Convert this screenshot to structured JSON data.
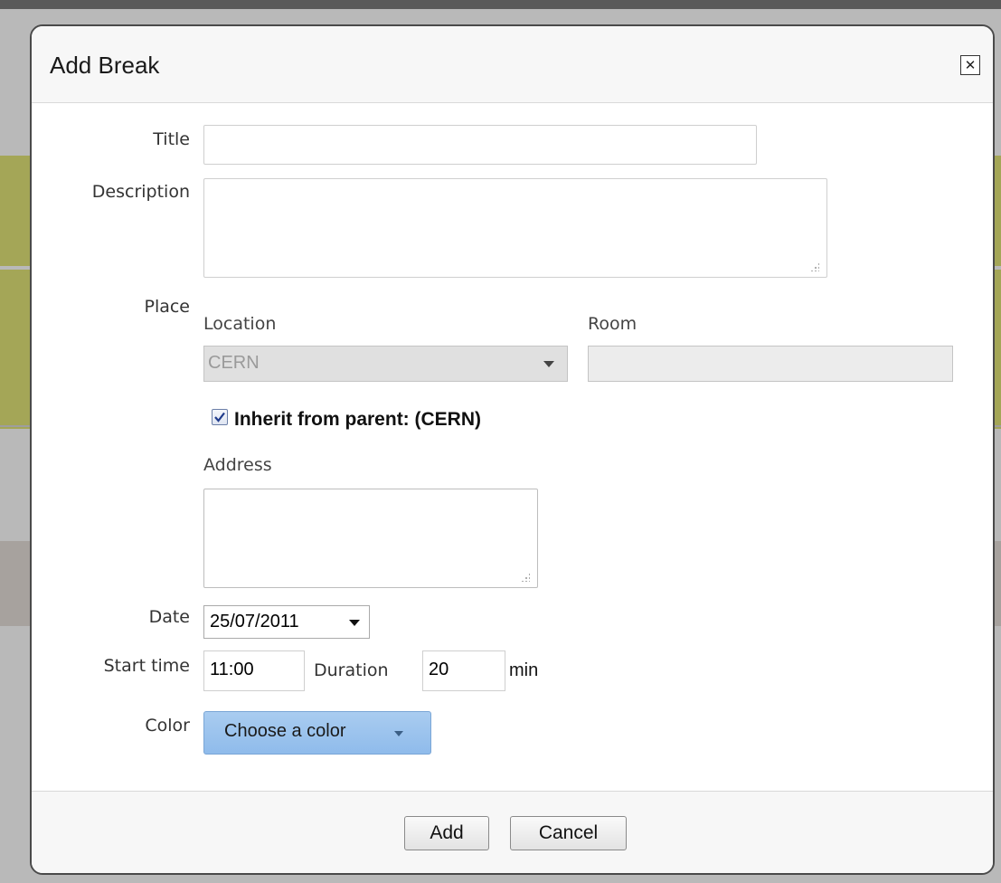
{
  "dialog": {
    "title": "Add Break",
    "close_icon": "close-icon"
  },
  "form": {
    "title_label": "Title",
    "title_value": "",
    "description_label": "Description",
    "description_value": "",
    "place_label": "Place",
    "location_label": "Location",
    "location_value": "CERN",
    "room_label": "Room",
    "room_value": "",
    "inherit_checked": true,
    "inherit_label": "Inherit from parent: (CERN)",
    "address_label": "Address",
    "address_value": "",
    "date_label": "Date",
    "date_value": "25/07/2011",
    "start_time_label": "Start time",
    "start_time_value": "11:00",
    "duration_label": "Duration",
    "duration_value": "20",
    "duration_unit": "min",
    "color_label": "Color",
    "color_button": "Choose a color",
    "color_button_bg": "#9ec4ee"
  },
  "footer": {
    "add_label": "Add",
    "cancel_label": "Cancel"
  }
}
